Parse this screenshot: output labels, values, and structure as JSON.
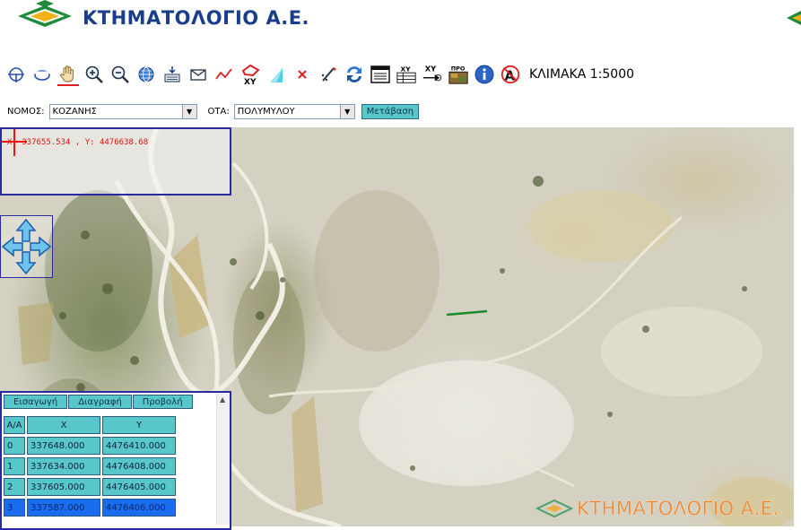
{
  "header": {
    "brand_name": "ΚΤΗΜΑΤΟΛΟΓΙΟ Α.Ε."
  },
  "toolbar": {
    "tools": [
      "identify-point-icon",
      "measure-area-icon",
      "pan-hand-icon",
      "zoom-in-icon",
      "zoom-out-icon",
      "full-extent-globe-icon",
      "reload-map-icon",
      "envelope-icon",
      "draw-line-icon",
      "draw-polygon-xy-icon",
      "draw-shape-icon",
      "clear-x-icon",
      "edit-pen-icon",
      "refresh-arrows-icon",
      "print-window-icon",
      "xy-list-icon",
      "xy-goto-icon",
      "pro-photo-icon",
      "info-icon",
      "no-label-icon"
    ],
    "scale_label": "ΚΛΙΜΑΚΑ 1:5000"
  },
  "selection": {
    "prefecture_label": "ΝΟΜΟΣ:",
    "prefecture_value": "ΚΟΖΑΝΗΣ",
    "municipality_label": "ΟΤΑ:",
    "municipality_value": "ΠΟΛΥΜΥΛΟΥ",
    "go_label": "Μετάβαση"
  },
  "map": {
    "coordinate_readout": "X: 337655.534 , Y: 4476638.68",
    "watermark_text": "ΚΤΗΜΑΤΟΛΟΓΙΟ Α.Ε.",
    "drawn_line_color": "#1a8a2a"
  },
  "vertex_panel": {
    "tabs": [
      "Εισαγωγή",
      "Διαγραφή",
      "Προβολή"
    ],
    "columns": [
      "Α/Α",
      "X",
      "Y"
    ],
    "rows": [
      {
        "id": "0",
        "x": "337648.000",
        "y": "4476410.000"
      },
      {
        "id": "1",
        "x": "337634.000",
        "y": "4476408.000"
      },
      {
        "id": "2",
        "x": "337605.000",
        "y": "4476405.000"
      },
      {
        "id": "3",
        "x": "337587.000",
        "y": "4476406.000"
      }
    ],
    "selected_row": "3"
  },
  "colors": {
    "brand_blue": "#1b3e8c",
    "brand_green": "#1f8a3a",
    "button_teal": "#58c7c9",
    "selected_row": "#1a6cf0",
    "panel_border": "#2a2aa0",
    "coordinate_red": "#dd1111"
  }
}
